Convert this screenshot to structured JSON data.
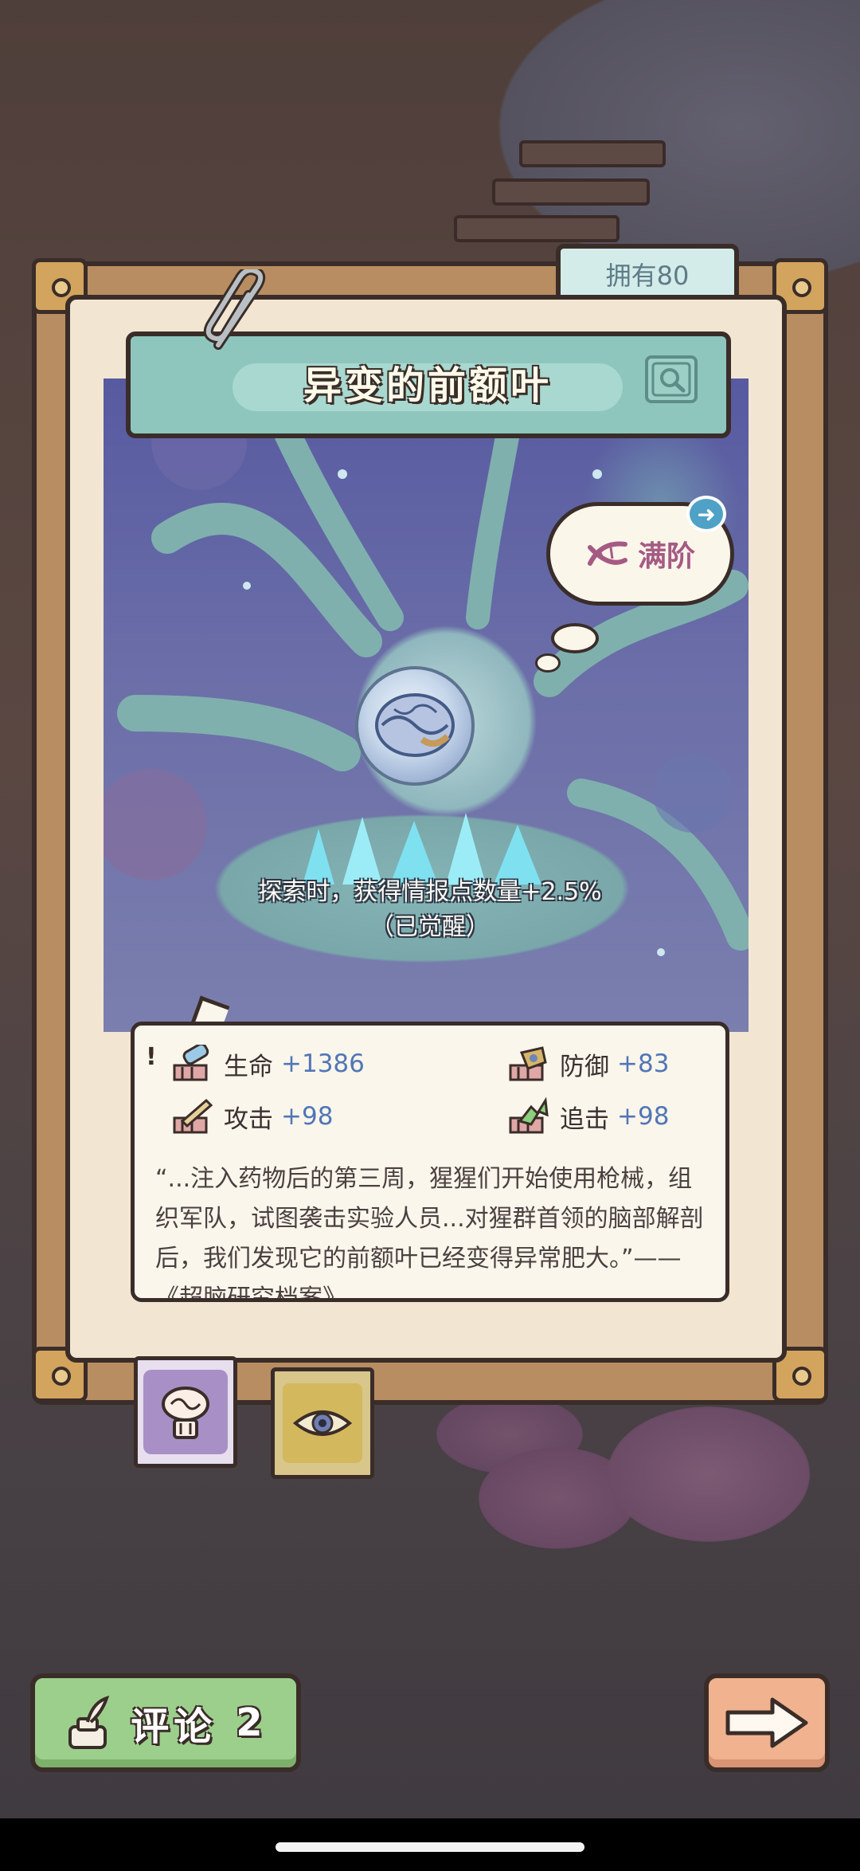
{
  "card": {
    "owned_label": "拥有80",
    "title": "异变的前额叶",
    "level_status": "满阶",
    "awaken_effect": "探索时，获得情报点数量+2.5%",
    "awaken_state": "（已觉醒）"
  },
  "stats": [
    {
      "name": "生命",
      "value": "+1386",
      "icon": "health-potion-icon"
    },
    {
      "name": "防御",
      "value": "+83",
      "icon": "defense-shield-icon"
    },
    {
      "name": "攻击",
      "value": "+98",
      "icon": "attack-sword-icon"
    },
    {
      "name": "追击",
      "value": "+98",
      "icon": "pursuit-arrow-icon"
    }
  ],
  "lore": {
    "exclaim": "!",
    "text": "“...注入药物后的第三周，猩猩们开始使用枪械，组织军队，试图袭击实验人员...对猩群首领的脑部解剖后，我们发现它的前额叶已经变得异常肥大。”——《超脑研究档案》"
  },
  "tabs": [
    {
      "name": "brain-tab",
      "icon": "brain-icon",
      "selected": true
    },
    {
      "name": "eye-tab",
      "icon": "eye-icon",
      "selected": false
    }
  ],
  "comment": {
    "label": "评论",
    "count": "2"
  },
  "colors": {
    "board": "#b98d62",
    "banner": "#8ec6bd",
    "stat_value": "#5276b6",
    "max_label": "#a55a84",
    "comment_button": "#9dcf8c",
    "next_button": "#f0b28f"
  }
}
